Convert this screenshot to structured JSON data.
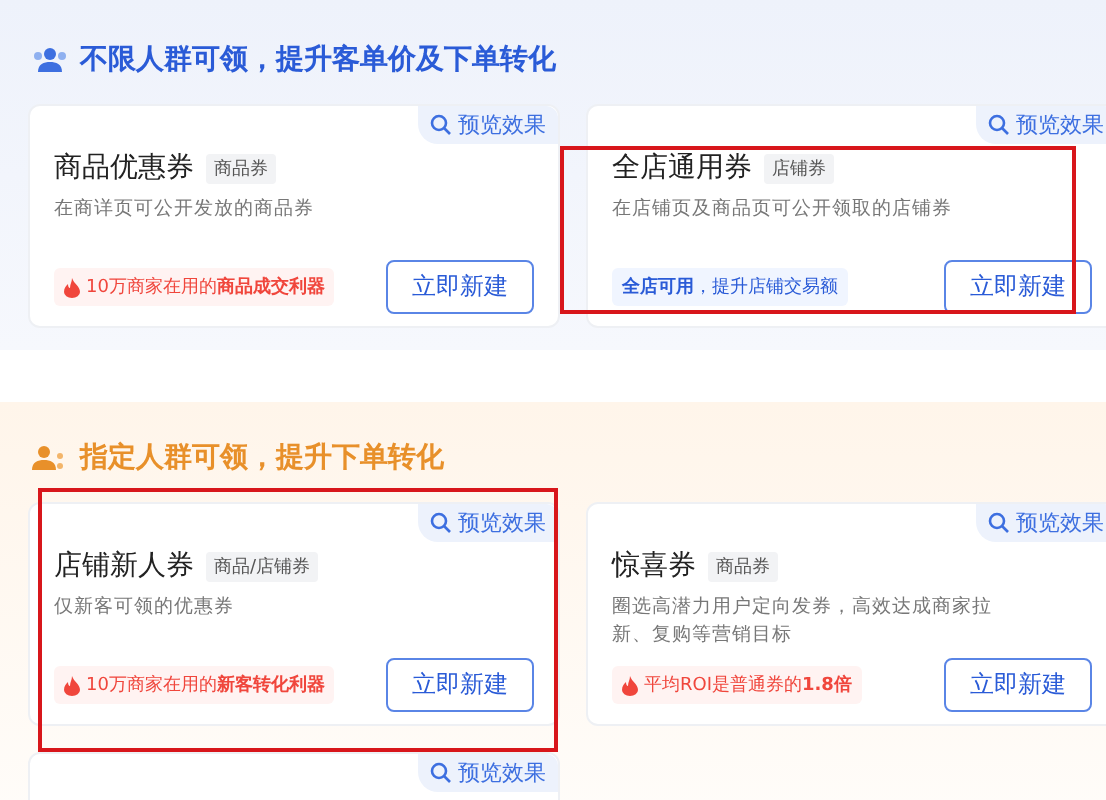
{
  "sections": [
    {
      "kind": "all",
      "title": "不限人群可领，提升客单价及下单转化",
      "cards": [
        {
          "title": "商品优惠券",
          "tag": "商品券",
          "preview": "预览效果",
          "description": "在商详页可公开发放的商品券",
          "hint": {
            "kind": "hot",
            "text": "10万商家在用的**商品成交利器**"
          },
          "button": "立即新建",
          "highlighted": false
        },
        {
          "title": "全店通用券",
          "tag": "店铺券",
          "preview": "预览效果",
          "description": "在店铺页及商品页可公开领取的店铺券",
          "hint": {
            "kind": "info",
            "text": "**全店可用**，提升店铺交易额"
          },
          "button": "立即新建",
          "highlighted": true
        }
      ]
    },
    {
      "kind": "targeted",
      "title": "指定人群可领，提升下单转化",
      "cards": [
        {
          "title": "店铺新人券",
          "tag": "商品/店铺券",
          "preview": "预览效果",
          "description": "仅新客可领的优惠券",
          "hint": {
            "kind": "hot",
            "text": "10万商家在用的**新客转化利器**"
          },
          "button": "立即新建",
          "highlighted": true
        },
        {
          "title": "惊喜券",
          "tag": "商品券",
          "preview": "预览效果",
          "description": "圈选高潜力用户定向发券，高效达成商家拉新、复购等营销目标",
          "hint": {
            "kind": "hot",
            "text": "平均ROI是普通券的**1.8倍**"
          },
          "button": "立即新建",
          "highlighted": false
        },
        {
          "preview": "预览效果",
          "highlighted": false
        }
      ]
    }
  ]
}
